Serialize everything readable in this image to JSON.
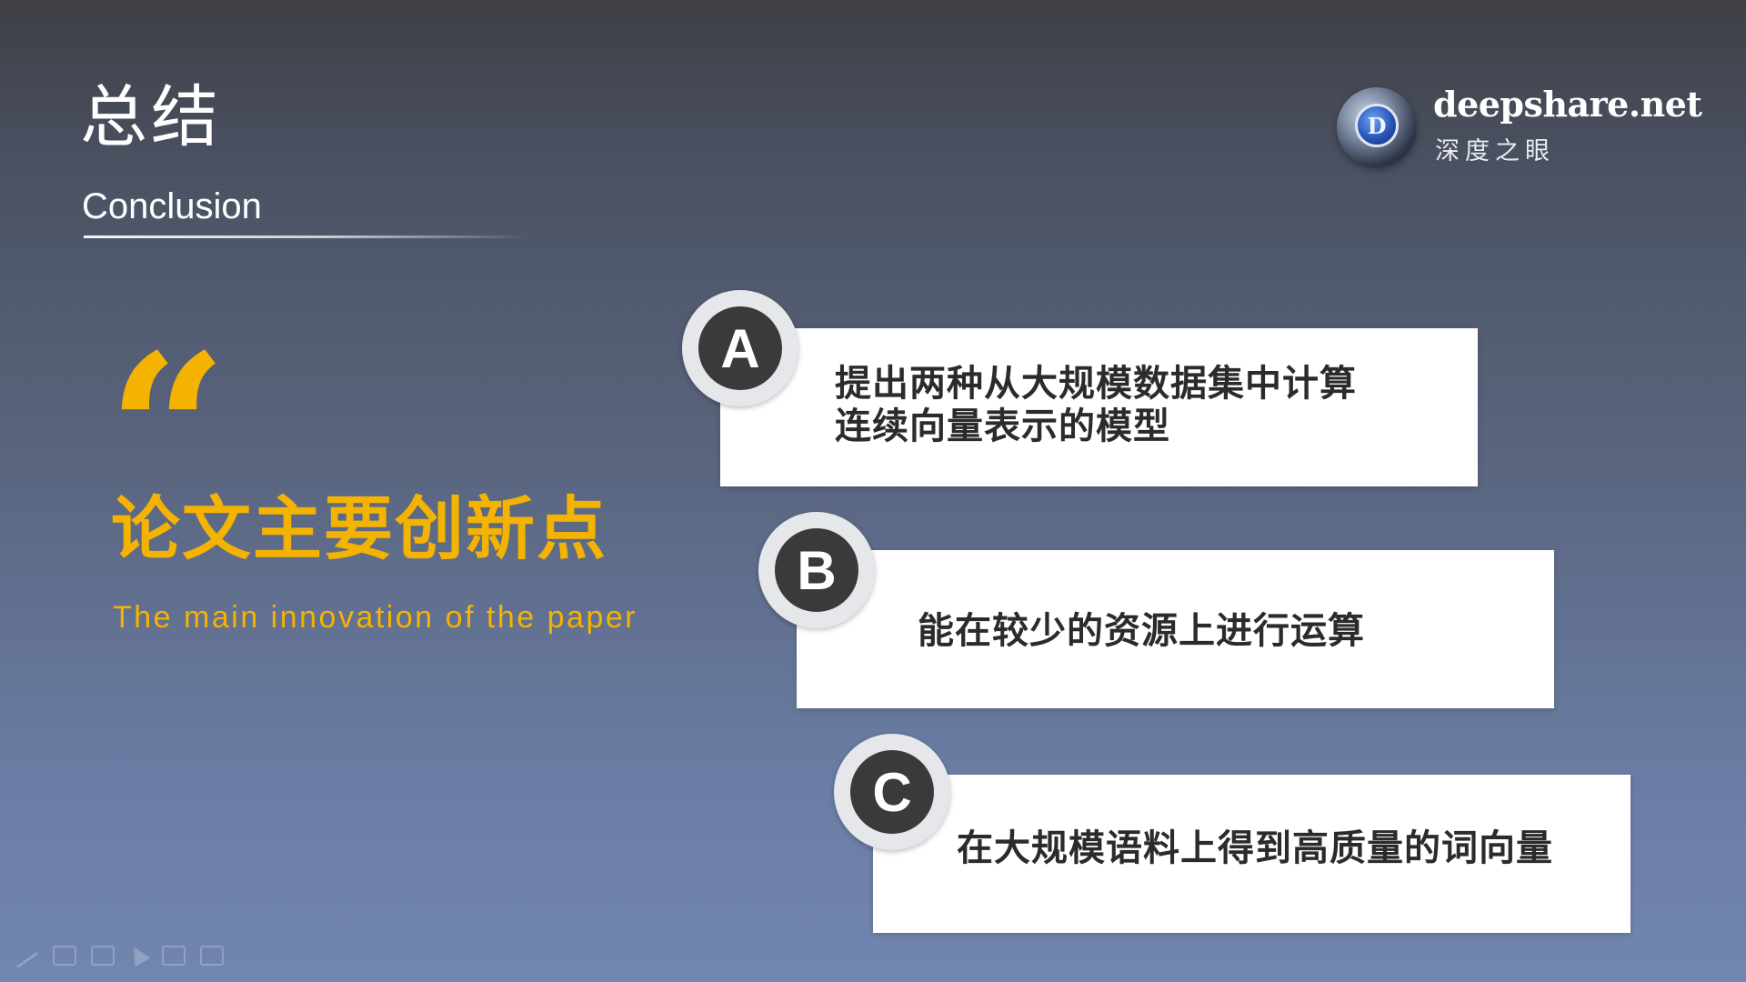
{
  "header": {
    "title_zh": "总结",
    "title_en": "Conclusion"
  },
  "logo": {
    "mark_letter": "D",
    "name": "deepshare.net",
    "sub": "深度之眼"
  },
  "left": {
    "quote_mark": "“",
    "heading_zh": "论文主要创新点",
    "heading_en": "The main innovation of the paper"
  },
  "items": [
    {
      "letter": "A",
      "text_line1": "提出两种从大规模数据集中计算",
      "text_line2": "连续向量表示的模型"
    },
    {
      "letter": "B",
      "text_line1": "能在较少的资源上进行运算"
    },
    {
      "letter": "C",
      "text_line1": "在大规模语料上得到高质量的词向量"
    }
  ],
  "colors": {
    "accent": "#f5b301",
    "card_bg": "#ffffff",
    "badge_disc": "#3a3a3a",
    "badge_ring": "#e6e7ea"
  },
  "toolbar": {
    "icons": [
      "pen-icon",
      "highlighter-icon",
      "eraser-icon",
      "arrow-icon",
      "cursor-icon",
      "screen-icon"
    ]
  }
}
